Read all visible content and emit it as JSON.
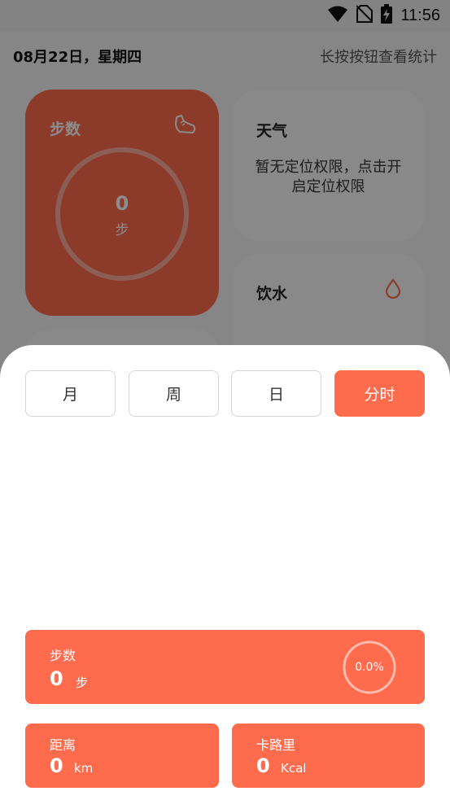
{
  "status_bar": {
    "time": "11:56"
  },
  "header": {
    "date": "08月22日，星期四",
    "hint": "长按按钮查看统计"
  },
  "steps_card": {
    "title": "步数",
    "value": "0",
    "unit": "步"
  },
  "weather_card": {
    "title": "天气",
    "message": "暂无定位权限，点击开启定位权限"
  },
  "water_card": {
    "title": "饮水"
  },
  "tabs": [
    {
      "label": "月",
      "active": false
    },
    {
      "label": "周",
      "active": false
    },
    {
      "label": "日",
      "active": false
    },
    {
      "label": "分时",
      "active": true
    }
  ],
  "stats": {
    "steps": {
      "label": "步数",
      "value": "0",
      "unit": "步",
      "progress_text": "0.0%",
      "progress": 0.0
    },
    "distance": {
      "label": "距离",
      "value": "0",
      "unit": "km"
    },
    "calories": {
      "label": "卡路里",
      "value": "0",
      "unit": "Kcal"
    }
  },
  "colors": {
    "accent": "#ff6b4d",
    "card_bg": "#fafafa"
  },
  "icons": [
    "wifi-icon",
    "no-sim-icon",
    "battery-charging-icon",
    "shoe-icon",
    "water-drop-icon"
  ]
}
